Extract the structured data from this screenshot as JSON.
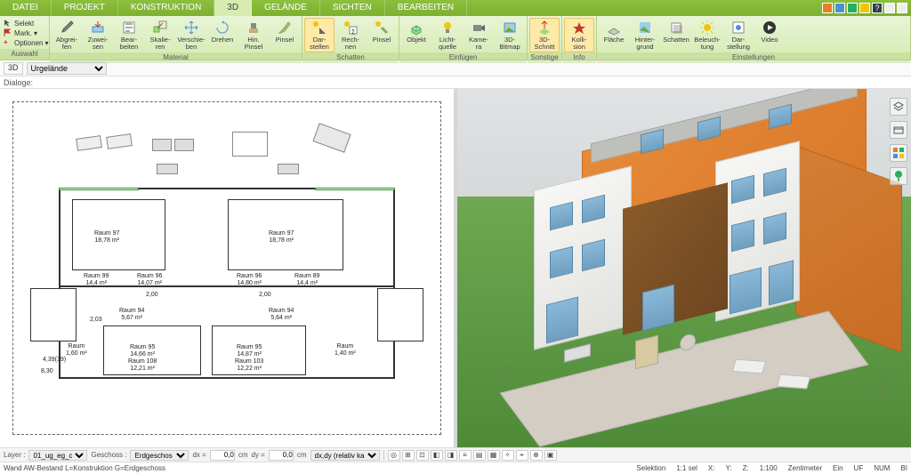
{
  "tabs": {
    "datei": "DATEI",
    "projekt": "PROJEKT",
    "konstruktion": "KONSTRUKTION",
    "d3": "3D",
    "gelaende": "GELÄNDE",
    "sichten": "SICHTEN",
    "bearbeiten": "BEARBEITEN"
  },
  "sel": {
    "selekt": "Selekt",
    "mark": "Mark.",
    "optionen": "Optionen"
  },
  "groups": {
    "auswahl": "Auswahl",
    "material": "Material",
    "schatten": "Schatten",
    "einfuegen": "Einfügen",
    "sonstige": "Sonstige",
    "info": "Info",
    "einstellungen": "Einstellungen"
  },
  "tools": {
    "abgreifen": "Abgrei-\nfen",
    "zuweisen": "Zuwei-\nsen",
    "bearbeiten": "Bear-\nbeiten",
    "skalieren": "Skalie-\nren",
    "verschieben": "Verschie-\nben",
    "drehen": "Drehen",
    "hinpinsel": "Hin.\nPinsel",
    "pinsel": "Pinsel",
    "darstellen": "Dar-\nstellen",
    "rechnen": "Rech-\nnen",
    "pinsel2": "Pinsel",
    "objekt": "Objekt",
    "lichtquelle": "Licht-\nquelle",
    "kamera": "Kame-\nra",
    "bitmap3d": "3D-\nBitmap",
    "schnitt3d": "3D-\nSchnitt",
    "kollision": "Kolli-\nsion",
    "flaeche": "Fläche",
    "hintergrund": "Hinter-\ngrund",
    "schatten2": "Schatten",
    "beleuchtung": "Beleuch-\ntung",
    "darstellung": "Dar-\nstellung",
    "video": "Video"
  },
  "subbar": {
    "d3": "3D",
    "urgelaende": "Urgelände"
  },
  "dialoge": "Dialoge:",
  "plan": {
    "r97a": {
      "name": "Raum 97",
      "area": "18,78 m²"
    },
    "r97b": {
      "name": "Raum 97",
      "area": "18,78 m²"
    },
    "r99l": {
      "name": "Raum 99",
      "area": "14,4 m²"
    },
    "r96l": {
      "name": "Raum 96",
      "area": "14,07 m²"
    },
    "r96r": {
      "name": "Raum 96",
      "area": "14,80 m²"
    },
    "r89": {
      "name": "Raum 89",
      "area": "14,4 m²"
    },
    "r94l": {
      "name": "Raum 94",
      "area": "5,67 m²"
    },
    "r94r": {
      "name": "Raum 94",
      "area": "5,64 m²"
    },
    "r106l": {
      "name": "Raum",
      "area": "1,60 m²"
    },
    "r106r": {
      "name": "Raum",
      "area": "1,40 m²"
    },
    "r95": {
      "name": "Raum 95",
      "area": "14,66 m²"
    },
    "r108": {
      "name": "Raum 108",
      "area": "12,21 m²"
    },
    "r95r": {
      "name": "Raum 95",
      "area": "14,87 m²"
    },
    "r103": {
      "name": "Raum 103",
      "area": "12,22 m²"
    },
    "dim200": "2,00",
    "dim203": "2,03",
    "dim830": "8,30",
    "dimh": "4,39(39)"
  },
  "bottombar": {
    "layer": "Layer :",
    "layerval": "01_ug_eg_og",
    "geschoss": "Geschoss :",
    "geschossval": "Erdgeschos",
    "dx": "dx =",
    "dy": "dy =",
    "zero": "0,0",
    "cm": "cm",
    "mode": "dx,dy (relativ ka"
  },
  "statusbar": {
    "left": "Wand AW-Bestand L=Konstruktion G=Erdgeschoss",
    "selektion": "Selektion",
    "sel11": "1:1 sel",
    "x": "X:",
    "y": "Y:",
    "z": "Z:",
    "scale": "1:100",
    "unit": "Zentimeter",
    "ein": "Ein",
    "uf": "UF",
    "num": "NUM",
    "bl": "BI"
  }
}
